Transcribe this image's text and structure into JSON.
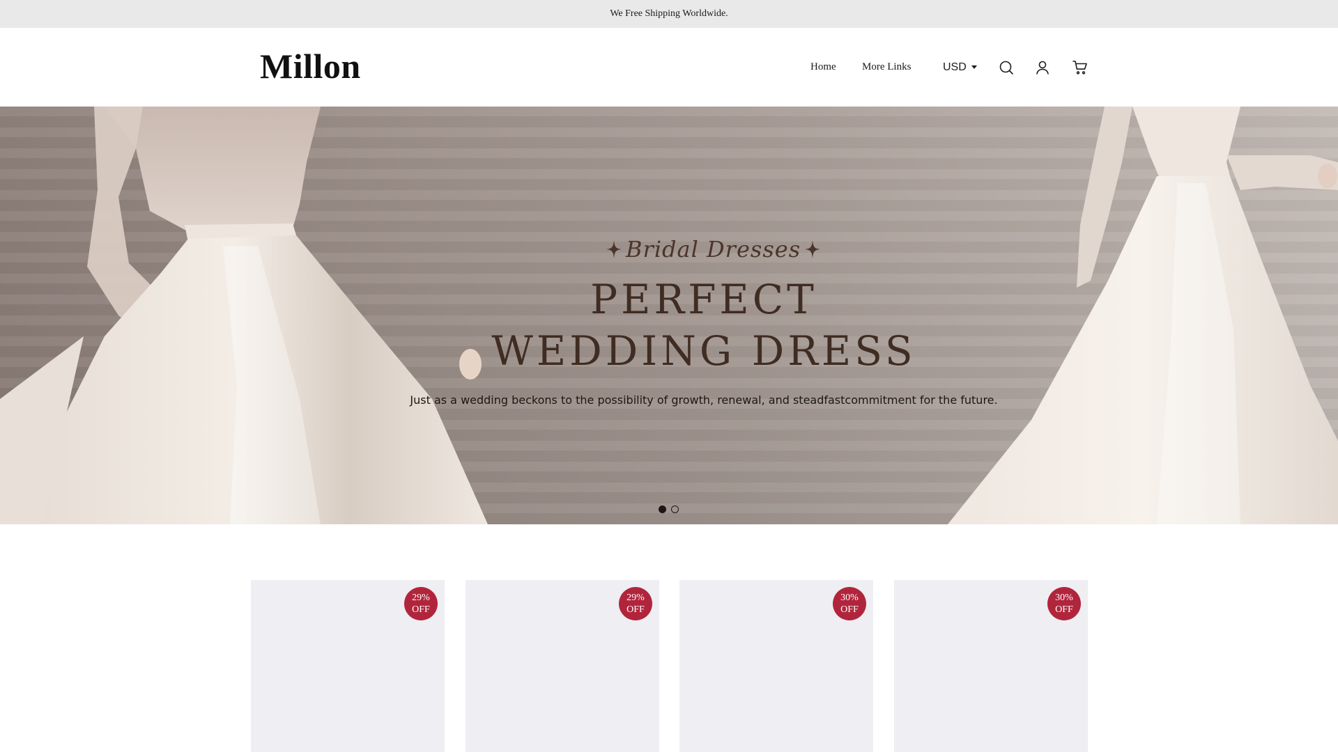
{
  "announcement": {
    "text": "We Free Shipping Worldwide."
  },
  "header": {
    "logo": "Millon",
    "nav": [
      {
        "label": "Home"
      },
      {
        "label": "More Links"
      }
    ],
    "currency": {
      "selected": "USD"
    },
    "icons": [
      "search-icon",
      "user-icon",
      "cart-icon"
    ]
  },
  "hero": {
    "eyebrow": "Bridal Dresses",
    "headline_line1": "PERFECT",
    "headline_line2": "WEDDING DRESS",
    "subtitle": "Just as a wedding beckons to the possibility of growth, renewal, and steadfastcommitment for the future.",
    "slides_total": 2,
    "active_slide": 1
  },
  "products": [
    {
      "badge_pct": "29%",
      "badge_off": "OFF"
    },
    {
      "badge_pct": "29%",
      "badge_off": "OFF"
    },
    {
      "badge_pct": "30%",
      "badge_off": "OFF"
    },
    {
      "badge_pct": "30%",
      "badge_off": "OFF"
    }
  ],
  "colors": {
    "announcement_bg": "#e9e9ea",
    "badge": "#b1253c",
    "hero_text": "#3f2c22",
    "product_placeholder": "#eeeef3"
  }
}
